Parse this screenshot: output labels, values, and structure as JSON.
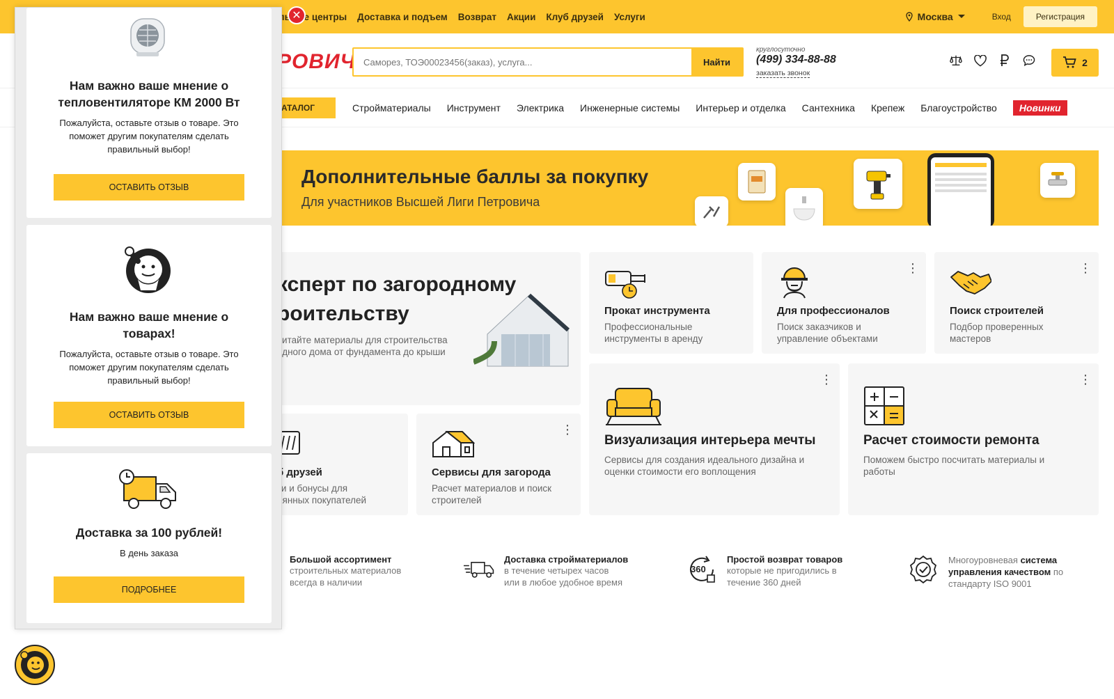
{
  "topnav": [
    "льные центры",
    "Доставка и подъем",
    "Возврат",
    "Акции",
    "Клуб друзей",
    "Услуги"
  ],
  "topright": {
    "city": "Москва",
    "login": "Вход",
    "register": "Регистрация"
  },
  "header": {
    "logo": "РОВИЧ",
    "search_placeholder": "Саморез, ТОЭ00023456(заказ), услуга...",
    "search_button": "Найти",
    "phone_sub": "круглосуточно",
    "phone": "(499) 334-88-88",
    "callback": "заказать звонок",
    "cart_count": "2"
  },
  "catalog": {
    "button": "АТАЛОГ",
    "items": [
      "Стройматериалы",
      "Инструмент",
      "Электрика",
      "Инженерные системы",
      "Интерьер и отделка",
      "Сантехника",
      "Крепеж",
      "Благоустройство"
    ],
    "new_badge": "Новинки"
  },
  "banner": {
    "title": "Дополнительные баллы за покупку",
    "subtitle": "Для участников Высшей Лиги Петровича"
  },
  "cards": {
    "expert_title_1": "ксперт по загородному",
    "expert_title_2": "роительству",
    "expert_desc_1": "читайте материалы для строительства",
    "expert_desc_2": "одного дома от фундамента до крыши",
    "rent_title": "Прокат инструмента",
    "rent_desc_1": "Профессиональные",
    "rent_desc_2": "инструменты в аренду",
    "pro_title": "Для профессионалов",
    "pro_desc_1": "Поиск заказчиков и",
    "pro_desc_2": "управление объектами",
    "builders_title": "Поиск строителей",
    "builders_desc_1": "Подбор проверенных",
    "builders_desc_2": "мастеров",
    "friends_title": "б друзей",
    "friends_desc_1": "ки и бонусы для",
    "friends_desc_2": "оянных покупателей",
    "country_title": "Сервисы для загорода",
    "country_desc_1": "Расчет материалов и поиск",
    "country_desc_2": "строителей",
    "viz_title": "Визуализация интерьера мечты",
    "viz_desc_1": "Сервисы для создания идеального дизайна и",
    "viz_desc_2": "оценки стоимости его воплощения",
    "calc_title": "Расчет стоимости ремонта",
    "calc_desc_1": "Поможем быстро посчитать материалы и",
    "calc_desc_2": "работы"
  },
  "features": [
    {
      "title": "Большой ассортимент",
      "desc_1": "строительных материалов",
      "desc_2": "всегда в наличии"
    },
    {
      "title": "Доставка стройматериалов",
      "desc_1": "в течение четырех часов",
      "desc_2": "или в любое удобное время"
    },
    {
      "title": "Простой возврат товаров",
      "desc_1": "которые не пригодились в",
      "desc_2": "течение 360 дней",
      "badge": "360"
    },
    {
      "pre": "Многоуровневая ",
      "title": "система",
      "title_2": "управления качеством",
      "desc_1": " по",
      "desc_2": "стандарту ISO 9001"
    }
  ],
  "popup": {
    "close": "✕",
    "card1": {
      "title_1": "Нам важно ваше мнение о",
      "title_2": "тепловентиляторе КМ 2000 Вт",
      "desc_1": "Пожалуйста, оставьте отзыв о товаре. Это",
      "desc_2": "поможет другим покупателям сделать",
      "desc_3": "правильный выбор!",
      "button": "ОСТАВИТЬ ОТЗЫВ"
    },
    "card2": {
      "title_1": "Нам важно ваше мнение о",
      "title_2": "товарах!",
      "desc_1": "Пожалуйста, оставьте отзыв о товаре. Это",
      "desc_2": "поможет другим покупателям сделать",
      "desc_3": "правильный выбор!",
      "button": "ОСТАВИТЬ ОТЗЫВ"
    },
    "card3": {
      "title": "Доставка за 100 рублей!",
      "desc": "В день заказа",
      "button": "ПОДРОБНЕЕ"
    }
  },
  "colors": {
    "brand_yellow": "#fdc52e",
    "brand_red": "#e1242e"
  }
}
